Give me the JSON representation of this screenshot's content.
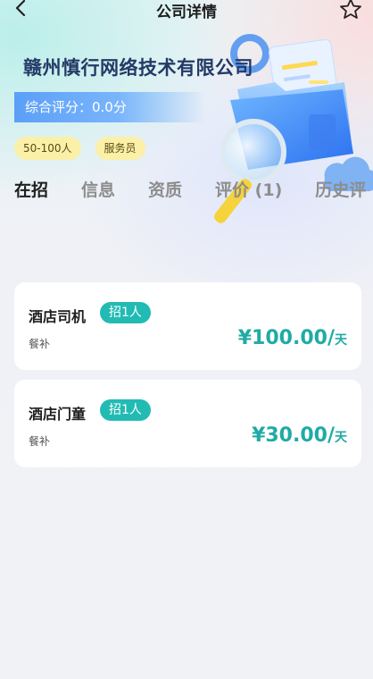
{
  "header": {
    "title": "公司详情"
  },
  "company": {
    "name": "赣州慎行网络技术有限公司",
    "score_label": "综合评分：0.0分",
    "tags": [
      "50-100人",
      "服务员"
    ]
  },
  "tabs": [
    {
      "label": "在招"
    },
    {
      "label": "信息"
    },
    {
      "label": "资质"
    },
    {
      "label": "评价 (1)"
    },
    {
      "label": "历史评"
    }
  ],
  "jobs": [
    {
      "title": "酒店司机",
      "recruit": "招1人",
      "benefit": "餐补",
      "salary": "¥100.00/",
      "unit": "天"
    },
    {
      "title": "酒店门童",
      "recruit": "招1人",
      "benefit": "餐补",
      "salary": "¥30.00/",
      "unit": "天"
    }
  ],
  "icons": {
    "back": "chevron-left-icon",
    "favorite": "star-outline-icon"
  },
  "colors": {
    "accent": "#22bbb3",
    "salary": "#20aba5",
    "score_bar": "#5b9ff8",
    "tag_bg": "#fbf0a7",
    "company_name": "#243a66"
  }
}
